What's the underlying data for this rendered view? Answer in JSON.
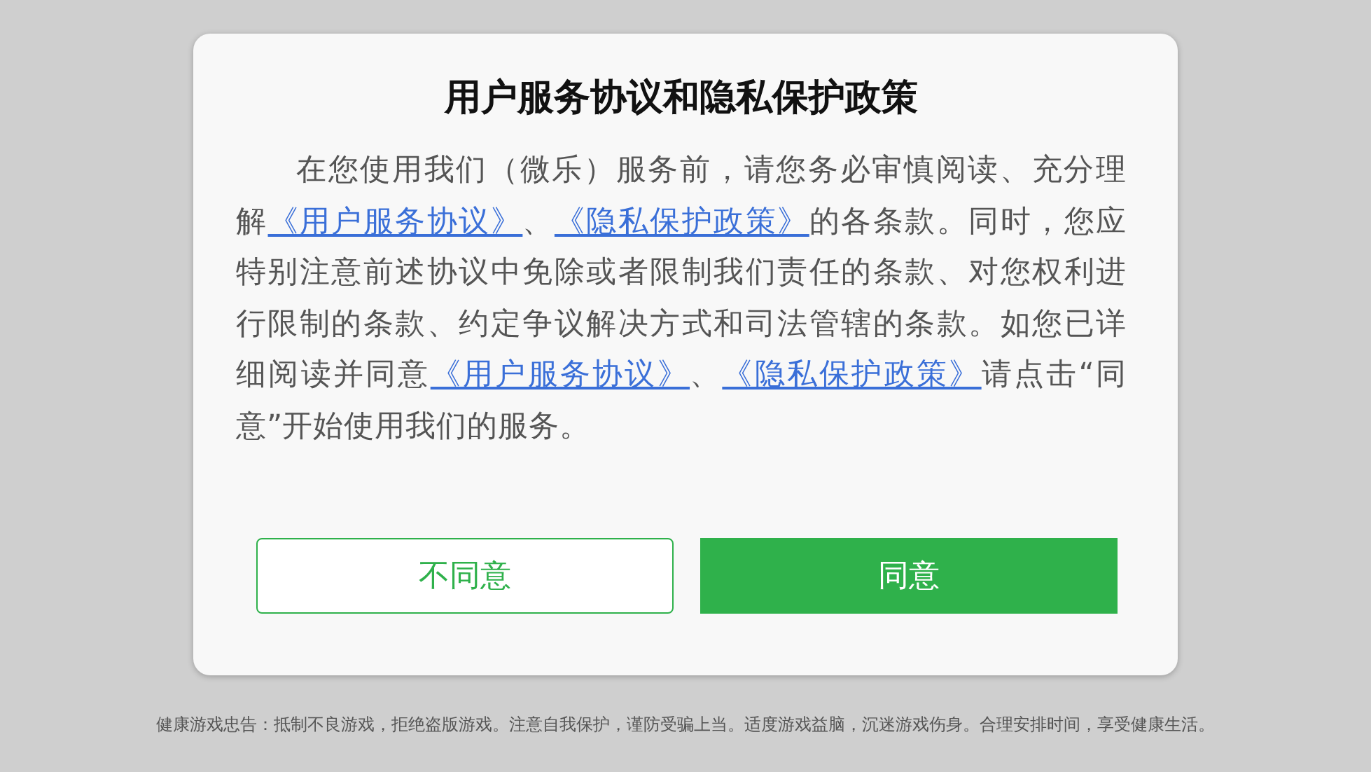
{
  "dialog": {
    "title": "用户服务协议和隐私保护政策",
    "paragraph": [
      {
        "kind": "text",
        "text": "在您使用我们（微乐）服务前，请您务必审慎阅读、充分理解"
      },
      {
        "kind": "link",
        "text": "《用户服务协议》"
      },
      {
        "kind": "text",
        "text": "、"
      },
      {
        "kind": "link",
        "text": "《隐私保护政策》"
      },
      {
        "kind": "text",
        "text": "的各条款。同时，您应特别注意前述协议中免除或者限制我们责任的条款、对您权利进行限制的条款、约定争议解决方式和司法管辖的条款。如您已详细阅读并同意"
      },
      {
        "kind": "link",
        "text": "《用户服务协议》"
      },
      {
        "kind": "text",
        "text": "、"
      },
      {
        "kind": "link",
        "text": "《隐私保护政策》"
      },
      {
        "kind": "text",
        "text": "请点击“同意”开始使用我们的服务。"
      }
    ],
    "buttons": [
      {
        "kind": "outline",
        "label": "不同意"
      },
      {
        "kind": "filled",
        "label": "同意"
      }
    ]
  },
  "footer": "健康游戏忠告：抵制不良游戏，拒绝盗版游戏。注意自我保护，谨防受骗上当。适度游戏益脑，沉迷游戏伤身。合理安排时间，享受健康生活。"
}
